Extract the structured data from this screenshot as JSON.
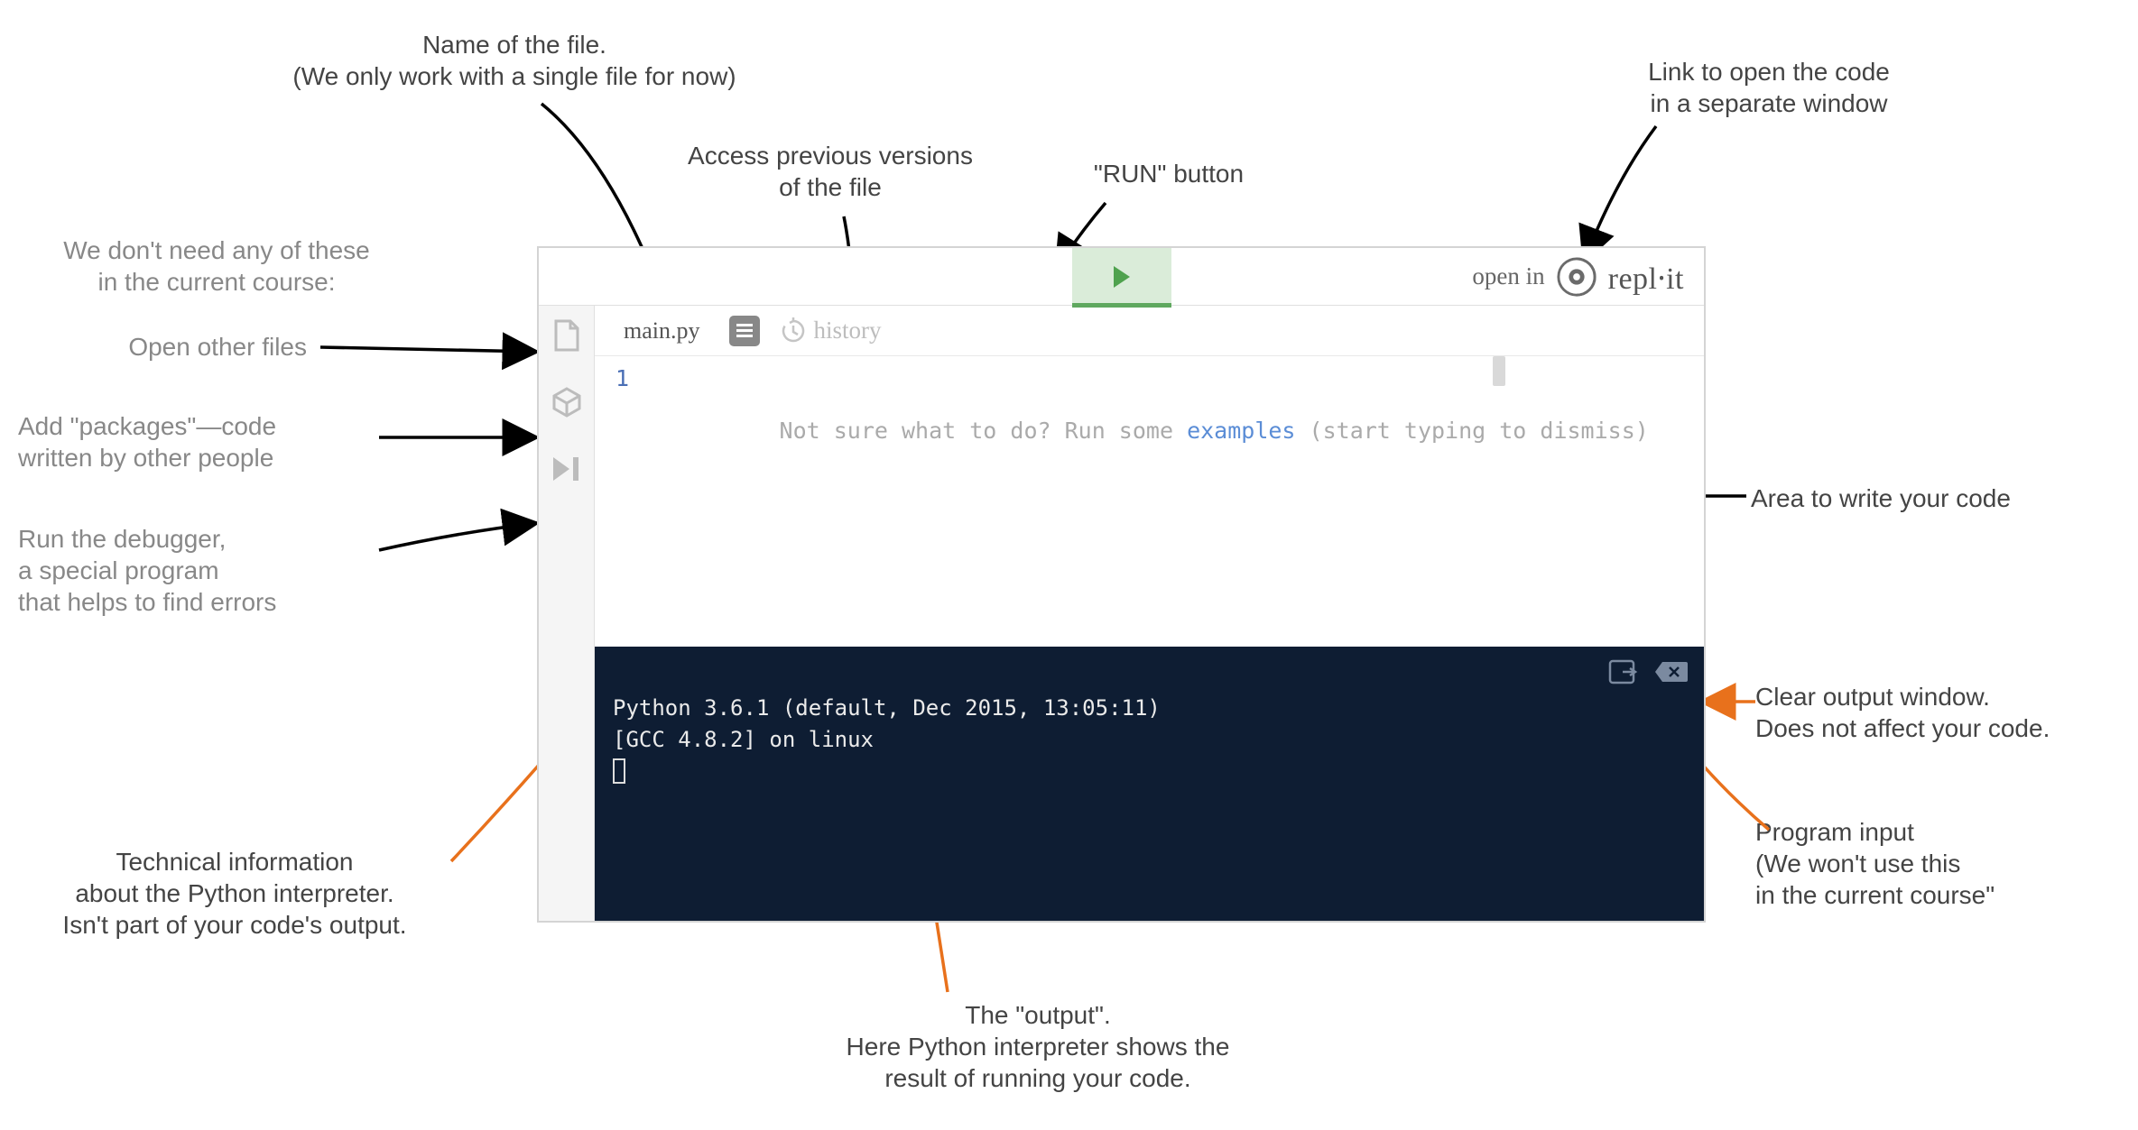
{
  "annotations": {
    "file_name_label": "Name of the file.\n(We only work with a single file for now)",
    "versions_label": "Access previous versions\nof the file",
    "run_label": "\"RUN\" button",
    "open_link_label": "Link to open the code\nin a separate window",
    "sidebar_intro": "We don't need any of these\nin the current course:",
    "open_files": "Open other files",
    "packages": "Add \"packages\"—code\nwritten by other people",
    "debugger": "Run the debugger,\na special program\nthat helps to find errors",
    "editor_area": "Area to write your code",
    "interp_info": "Technical information\nabout the Python interpreter.\nIsn't part of your code's output.",
    "output_label": "The \"output\".\nHere Python interpreter shows the\nresult of running your code.",
    "clear_label": "Clear output window.\nDoes not affect your code.",
    "input_label": "Program input\n(We won't use this\nin the current course\""
  },
  "repl": {
    "open_in": "open in",
    "logo_text": "repl⸱it",
    "file_tab": "main.py",
    "history": "history",
    "gutter_line1": "1",
    "placeholder_pre": "Not sure what to do? Run some ",
    "placeholder_kw": "examples",
    "placeholder_post": " (start typing to dismiss)",
    "console_line1": "Python 3.6.1 (default, Dec 2015, 13:05:11)",
    "console_line2": "[GCC 4.8.2] on linux"
  }
}
